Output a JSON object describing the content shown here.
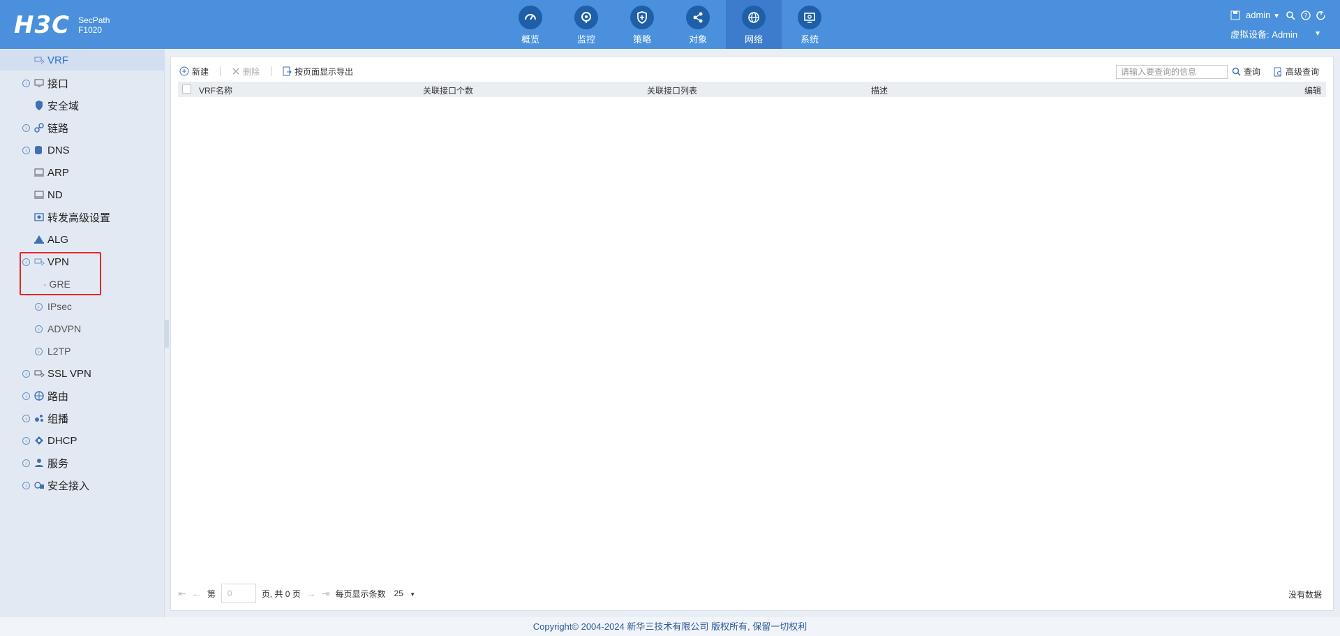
{
  "header": {
    "logo": "H3C",
    "product_line": "SecPath",
    "model": "F1020",
    "nav": [
      {
        "label": "概览",
        "icon": "gauge-icon"
      },
      {
        "label": "监控",
        "icon": "monitor-eye-icon"
      },
      {
        "label": "策略",
        "icon": "shield-icon"
      },
      {
        "label": "对象",
        "icon": "share-icon"
      },
      {
        "label": "网络",
        "icon": "globe-icon"
      },
      {
        "label": "系统",
        "icon": "screen-gear-icon"
      }
    ],
    "active_nav": "网络",
    "user": "admin",
    "virtual_device_label": "虚拟设备: Admin"
  },
  "sidebar": {
    "items": [
      {
        "label": "VRF",
        "icon": "vrf-icon"
      },
      {
        "label": "接口",
        "icon": "interface-icon"
      },
      {
        "label": "安全域",
        "icon": "security-zone-icon"
      },
      {
        "label": "链路",
        "icon": "link-icon"
      },
      {
        "label": "DNS",
        "icon": "dns-icon"
      },
      {
        "label": "ARP",
        "icon": "arp-icon"
      },
      {
        "label": "ND",
        "icon": "nd-icon"
      },
      {
        "label": "转发高级设置",
        "icon": "forwarding-settings-icon"
      },
      {
        "label": "ALG",
        "icon": "alg-icon"
      },
      {
        "label": "VPN",
        "icon": "vpn-icon"
      },
      {
        "label": "SSL VPN",
        "icon": "ssl-vpn-icon"
      },
      {
        "label": "路由",
        "icon": "routing-icon"
      },
      {
        "label": "组播",
        "icon": "multicast-icon"
      },
      {
        "label": "DHCP",
        "icon": "dhcp-icon"
      },
      {
        "label": "服务",
        "icon": "service-icon"
      },
      {
        "label": "安全接入",
        "icon": "secure-access-icon"
      }
    ],
    "vpn_children": [
      {
        "label": "· GRE"
      },
      {
        "label": "IPsec"
      },
      {
        "label": "ADVPN"
      },
      {
        "label": "L2TP"
      }
    ]
  },
  "toolbar": {
    "new_label": "新建",
    "delete_label": "删除",
    "export_label": "按页面显示导出",
    "search_placeholder": "请输入要查询的信息",
    "search_label": "查询",
    "advanced_search_label": "高级查询"
  },
  "table": {
    "columns": [
      "VRF名称",
      "关联接口个数",
      "关联接口列表",
      "描述",
      "编辑"
    ],
    "rows": []
  },
  "pager": {
    "page_prefix": "第",
    "page_value": "0",
    "page_suffix": "页, 共 0 页",
    "per_page_label": "每页显示条数",
    "per_page_value": "25",
    "empty_text": "没有数据"
  },
  "footer": {
    "copyright": "Copyright© 2004-2024 新华三技术有限公司 版权所有, 保留一切权利"
  },
  "colors": {
    "header_bg": "#4a90dc",
    "accent": "#2d6fc7",
    "highlight_box": "#e8242a"
  }
}
